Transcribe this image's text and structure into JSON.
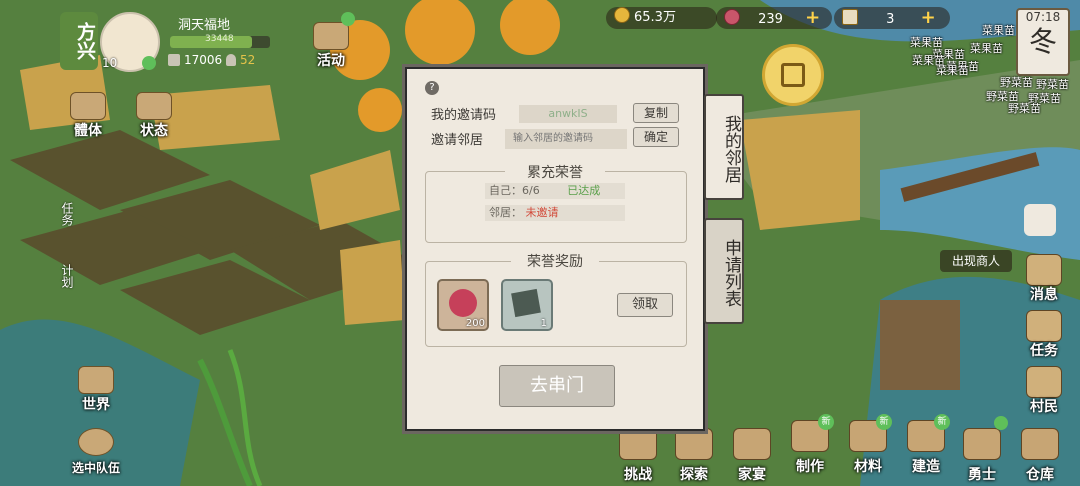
{
  "player": {
    "region_name": "方兴",
    "map_name": "洞天福地",
    "level": "10",
    "exp": "33448",
    "stone": "17006",
    "villagers": "52"
  },
  "resources": {
    "coins": "65.3万",
    "gems": "239",
    "tickets": "3",
    "time": "07:18",
    "season": "冬"
  },
  "left_menu": {
    "activity": "活动",
    "physique": "體体",
    "status": "状态",
    "task": "任务",
    "plan": "计划",
    "world": "世界",
    "select_team": "选中队伍"
  },
  "dialog": {
    "my_code_label": "我的邀请码",
    "my_code_value": "anwkIS",
    "copy_label": "复制",
    "invite_label": "邀请邻居",
    "invite_placeholder": "输入邻居的邀请码",
    "confirm_label": "确定",
    "honor_title": "累充荣誉",
    "self_label": "自己：6/6",
    "self_status": "已达成",
    "neighbor_label": "邻居：",
    "neighbor_status": "未邀请",
    "reward_title": "荣誉奖励",
    "reward1_count": "200",
    "reward2_count": "1",
    "claim_label": "领取",
    "visit_label": "去串门",
    "tab_neighbors": "我的邻居",
    "tab_requests": "申请列表"
  },
  "right_menu": {
    "merchant": "出现商人",
    "message": "消息",
    "task": "任务",
    "villager": "村民"
  },
  "bottom_menu": [
    {
      "label": "挑战",
      "new": ""
    },
    {
      "label": "探索",
      "new": ""
    },
    {
      "label": "家宴",
      "new": ""
    },
    {
      "label": "制作",
      "new": "新"
    },
    {
      "label": "材料",
      "new": "新"
    },
    {
      "label": "建造",
      "new": "新"
    },
    {
      "label": "勇士",
      "new": ""
    },
    {
      "label": "仓库",
      "new": ""
    }
  ],
  "crops": [
    "菜果苗",
    "菜果苗",
    "菜果苗",
    "菜果苗",
    "菜果苗",
    "菜果苗",
    "菜果苗",
    "野菜苗",
    "野菜苗",
    "野菜苗",
    "野菜苗",
    "野菜苗"
  ],
  "colors": {
    "accent": "#e6b63c",
    "panel": "#efe9df",
    "exp_bar": "#7fb14f",
    "reached": "#5aa04a",
    "not_invited": "#d24a3a"
  }
}
